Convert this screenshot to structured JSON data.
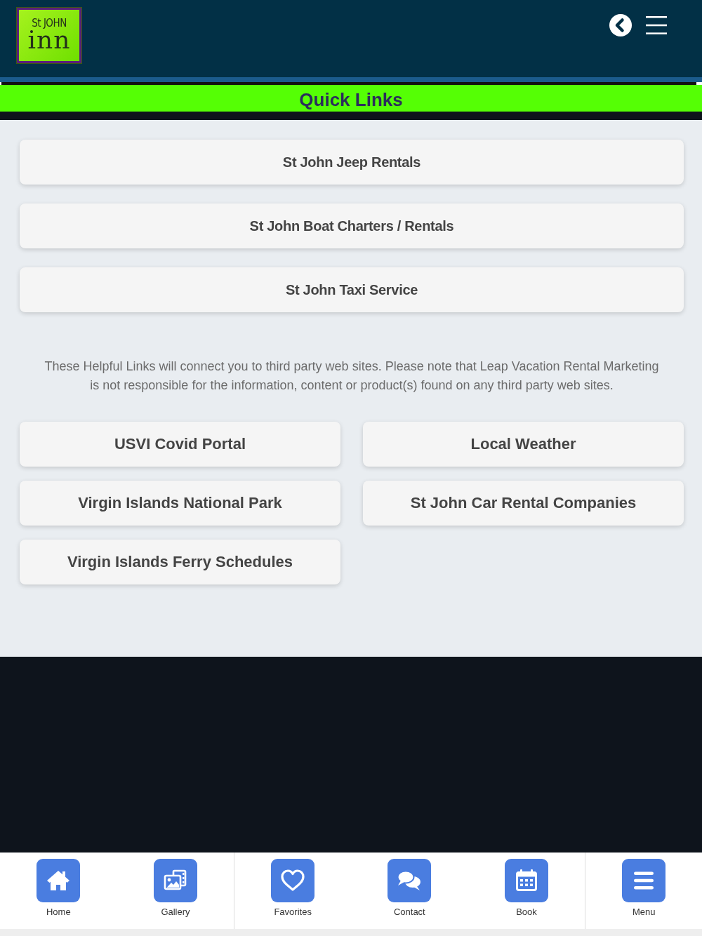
{
  "header": {
    "logo": {
      "line_1": "St JOHN",
      "line_2": "inn"
    }
  },
  "title": "Quick Links",
  "quick_links": [
    "St John Jeep Rentals",
    "St John Boat Charters / Rentals",
    "St John Taxi Service"
  ],
  "disclaimer": "These Helpful Links will connect you to third party web sites. Please note that Leap Vacation Rental Marketing is not responsible for the information, content or product(s) found on any third party web sites.",
  "helpful_links": [
    "USVI Covid Portal",
    "Local Weather",
    "Virgin Islands National Park",
    "St John Car Rental Companies",
    "Virgin Islands Ferry Schedules"
  ],
  "bottom_nav": [
    {
      "label": "Home"
    },
    {
      "label": "Gallery"
    },
    {
      "label": "Favorites"
    },
    {
      "label": "Contact"
    },
    {
      "label": "Book"
    },
    {
      "label": "Menu"
    }
  ]
}
